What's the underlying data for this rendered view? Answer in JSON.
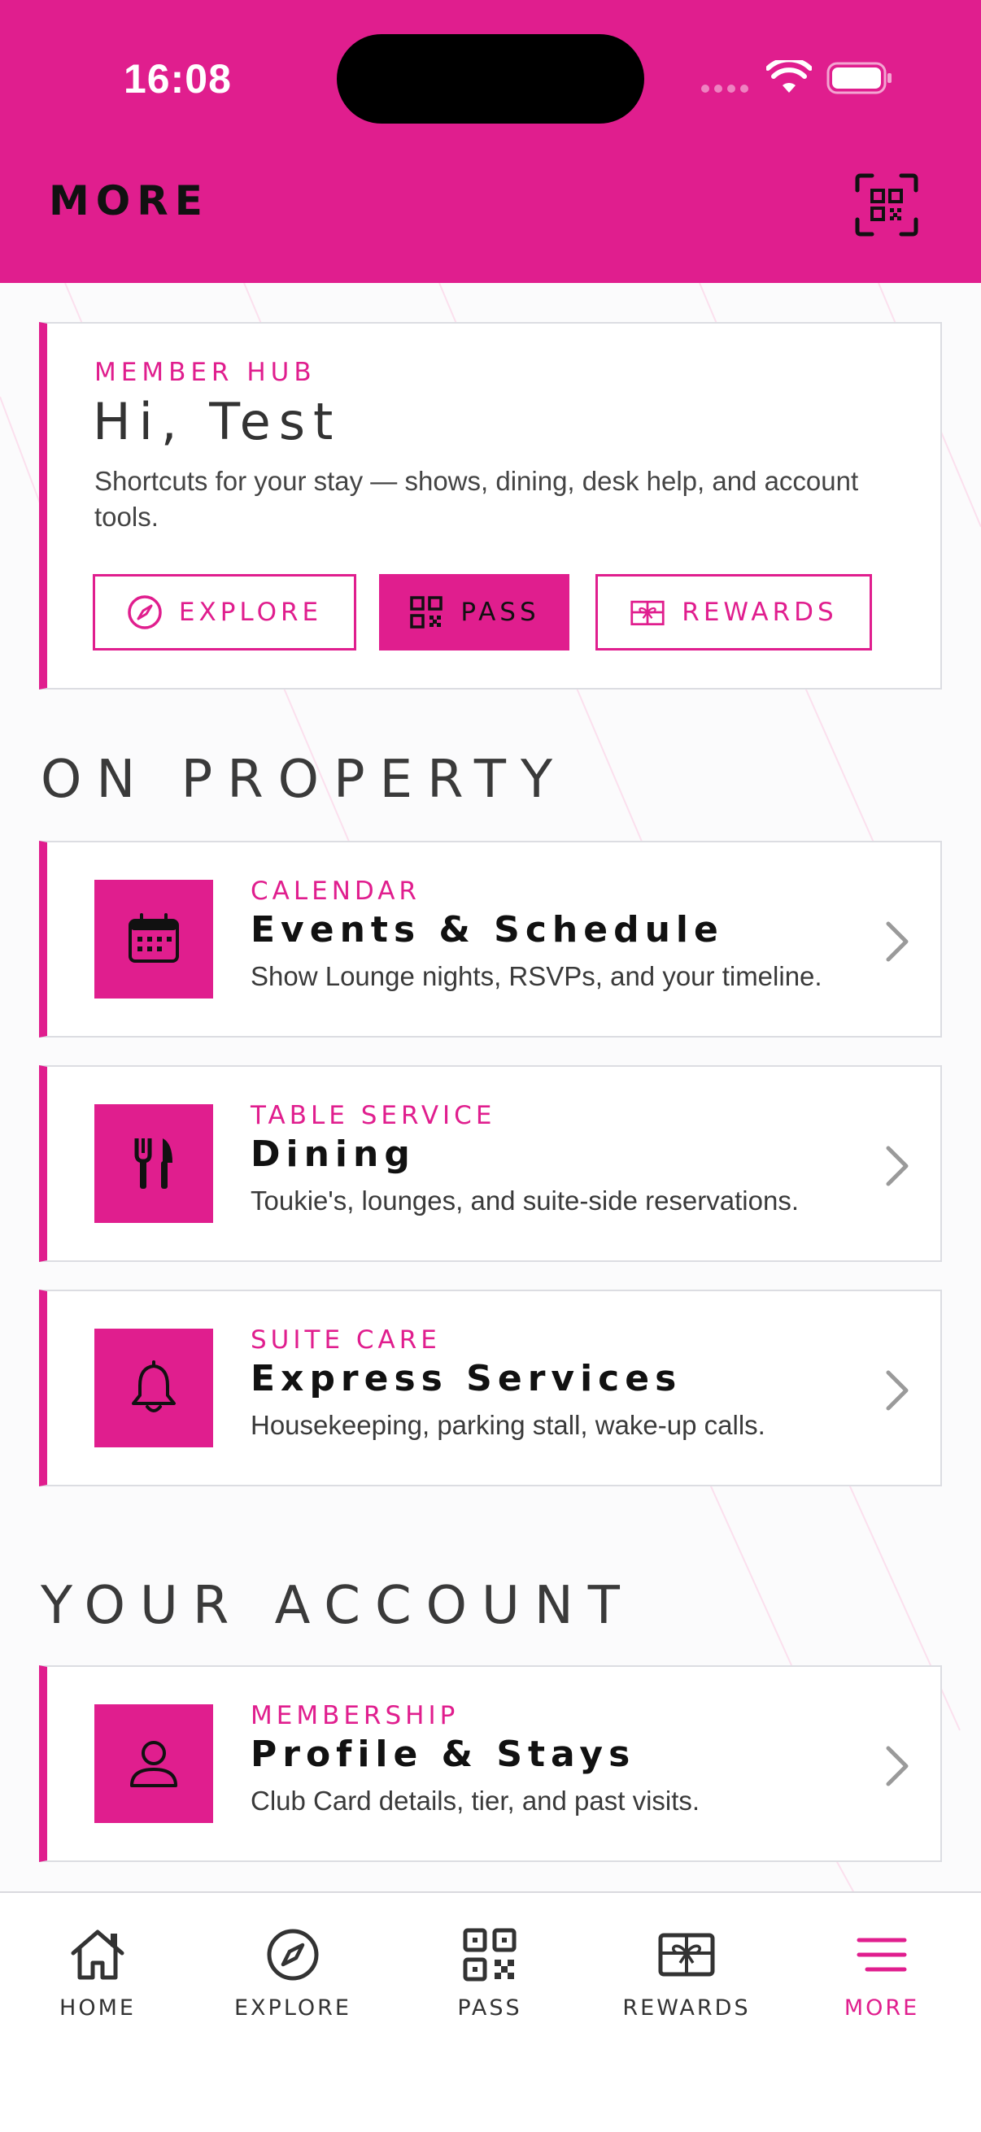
{
  "status_bar": {
    "time": "16:08"
  },
  "header": {
    "title": "MORE",
    "scan_icon": "qr-scan-icon"
  },
  "hub": {
    "eyebrow": "MEMBER HUB",
    "greeting": "Hi, Test",
    "description": "Shortcuts for your stay — shows, dining, desk help, and account tools.",
    "buttons": [
      {
        "label": "EXPLORE",
        "icon": "compass-icon"
      },
      {
        "label": "PASS",
        "icon": "qr-code-icon"
      },
      {
        "label": "REWARDS",
        "icon": "gift-icon"
      }
    ]
  },
  "sections": {
    "on_property": "ON PROPERTY",
    "your_account": "YOUR ACCOUNT"
  },
  "rows": {
    "calendar": {
      "eyebrow": "CALENDAR",
      "title": "Events & Schedule",
      "desc": "Show Lounge nights, RSVPs, and your timeline.",
      "icon": "calendar-icon"
    },
    "dining": {
      "eyebrow": "TABLE SERVICE",
      "title": "Dining",
      "desc": "Toukie's, lounges, and suite-side reservations.",
      "icon": "fork-knife-icon"
    },
    "services": {
      "eyebrow": "SUITE CARE",
      "title": "Express Services",
      "desc": "Housekeeping, parking stall, wake-up calls.",
      "icon": "bell-icon"
    },
    "profile": {
      "eyebrow": "MEMBERSHIP",
      "title": "Profile & Stays",
      "desc": "Club Card details, tier, and past visits.",
      "icon": "person-icon"
    }
  },
  "tabs": [
    {
      "label": "HOME",
      "icon": "home-icon"
    },
    {
      "label": "EXPLORE",
      "icon": "compass-icon"
    },
    {
      "label": "PASS",
      "icon": "qr-code-icon"
    },
    {
      "label": "REWARDS",
      "icon": "gift-icon"
    },
    {
      "label": "MORE",
      "icon": "menu-icon",
      "active": true
    }
  ],
  "colors": {
    "accent": "#e01e8e",
    "text": "#111111"
  }
}
